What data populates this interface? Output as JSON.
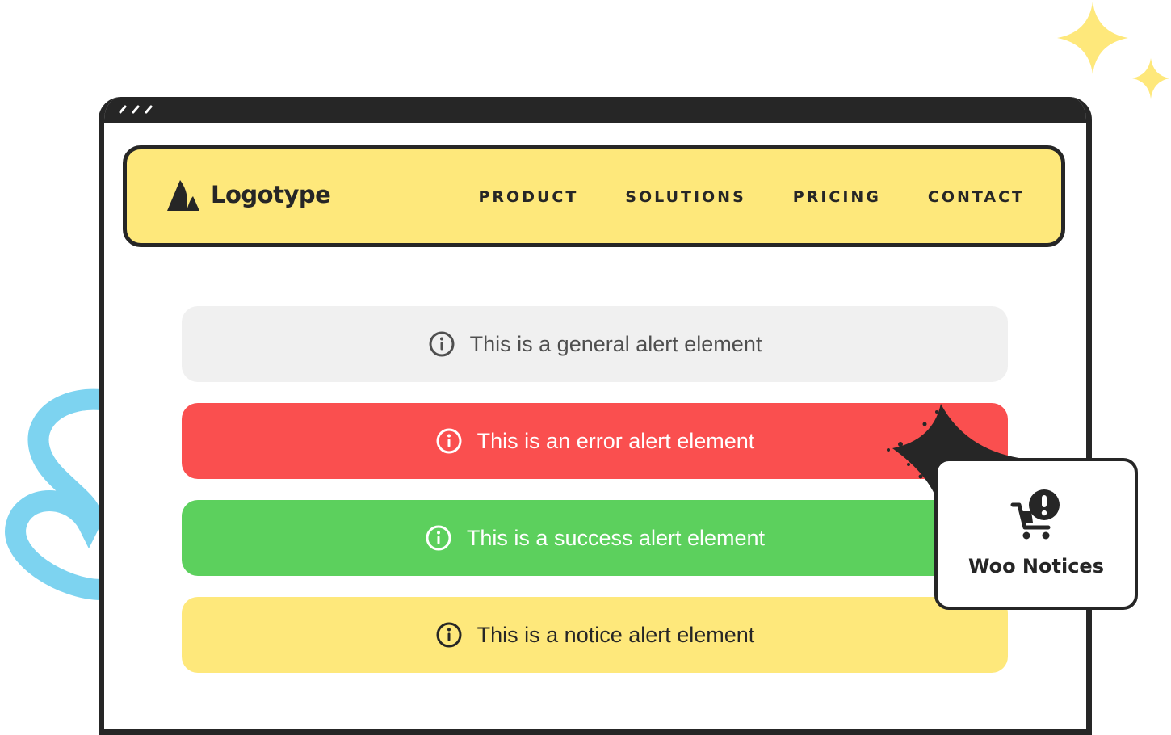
{
  "nav": {
    "logo_text": "Logotype",
    "items": [
      {
        "label": "PRODUCT"
      },
      {
        "label": "SOLUTIONS"
      },
      {
        "label": "PRICING"
      },
      {
        "label": "CONTACT"
      }
    ]
  },
  "alerts": [
    {
      "type": "general",
      "text": "This is a general alert element",
      "icon": "info-icon",
      "bg": "#f0f0f0",
      "fg": "#4f4f4f"
    },
    {
      "type": "error",
      "text": "This is an error alert element",
      "icon": "info-icon",
      "bg": "#fa4f4f",
      "fg": "#ffffff"
    },
    {
      "type": "success",
      "text": "This is a success alert element",
      "icon": "info-icon",
      "bg": "#5cd05d",
      "fg": "#ffffff"
    },
    {
      "type": "notice",
      "text": "This is a notice alert element",
      "icon": "info-icon",
      "bg": "#fee87b",
      "fg": "#262626"
    }
  ],
  "badge": {
    "label": "Woo Notices",
    "icon": "cart-alert-icon"
  },
  "colors": {
    "accent_yellow": "#fee87b",
    "frame": "#262626",
    "sparkle": "#fee87b",
    "squiggle": "#7dd3f0"
  }
}
